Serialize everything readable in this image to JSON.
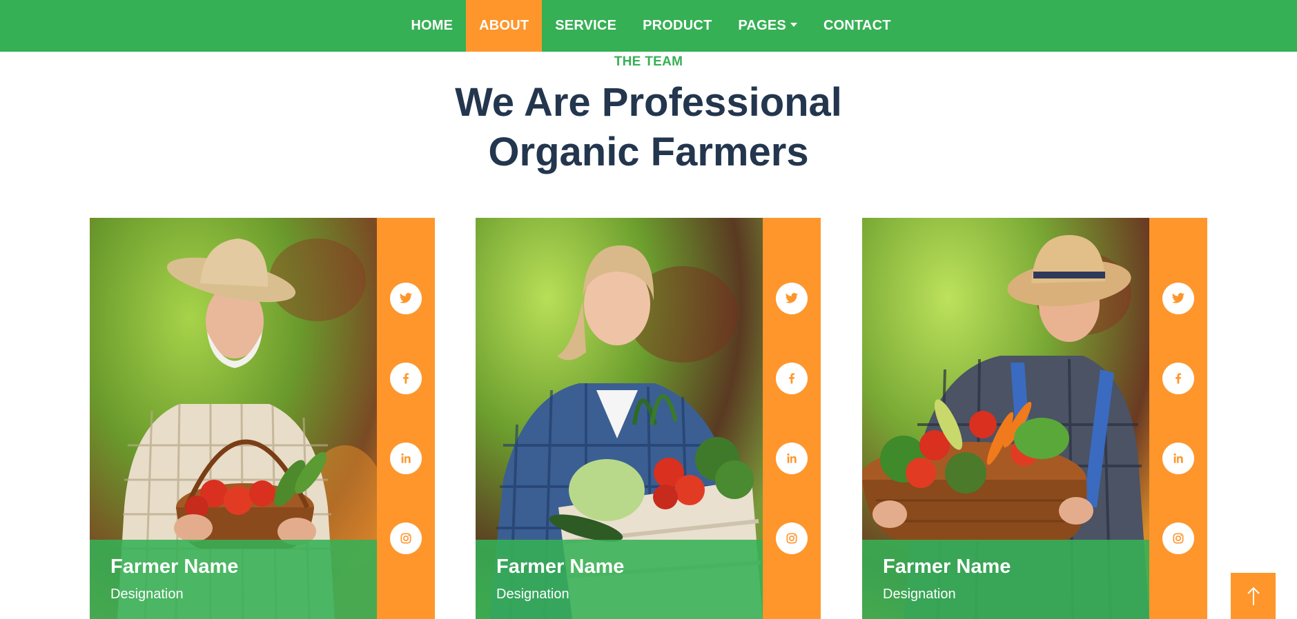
{
  "nav": {
    "items": [
      {
        "label": "HOME"
      },
      {
        "label": "ABOUT"
      },
      {
        "label": "SERVICE"
      },
      {
        "label": "PRODUCT"
      },
      {
        "label": "PAGES"
      },
      {
        "label": "CONTACT"
      }
    ],
    "active": "ABOUT"
  },
  "section": {
    "eyebrow": "THE TEAM",
    "title_line1": "We Are Professional",
    "title_line2": "Organic Farmers"
  },
  "team": [
    {
      "name": "Farmer Name",
      "designation": "Designation",
      "photo": "farmer-with-vegetable-basket"
    },
    {
      "name": "Farmer Name",
      "designation": "Designation",
      "photo": "farmer-with-vegetable-crate"
    },
    {
      "name": "Farmer Name",
      "designation": "Designation",
      "photo": "farmer-with-vegetable-basket"
    }
  ],
  "social_icons": [
    "twitter-icon",
    "facebook-icon",
    "linkedin-icon",
    "instagram-icon"
  ],
  "colors": {
    "primary_green": "#36b055",
    "accent_orange": "#fe962c",
    "heading_navy": "#23364e",
    "white": "#ffffff"
  },
  "back_to_top_icon": "arrow-up-icon"
}
